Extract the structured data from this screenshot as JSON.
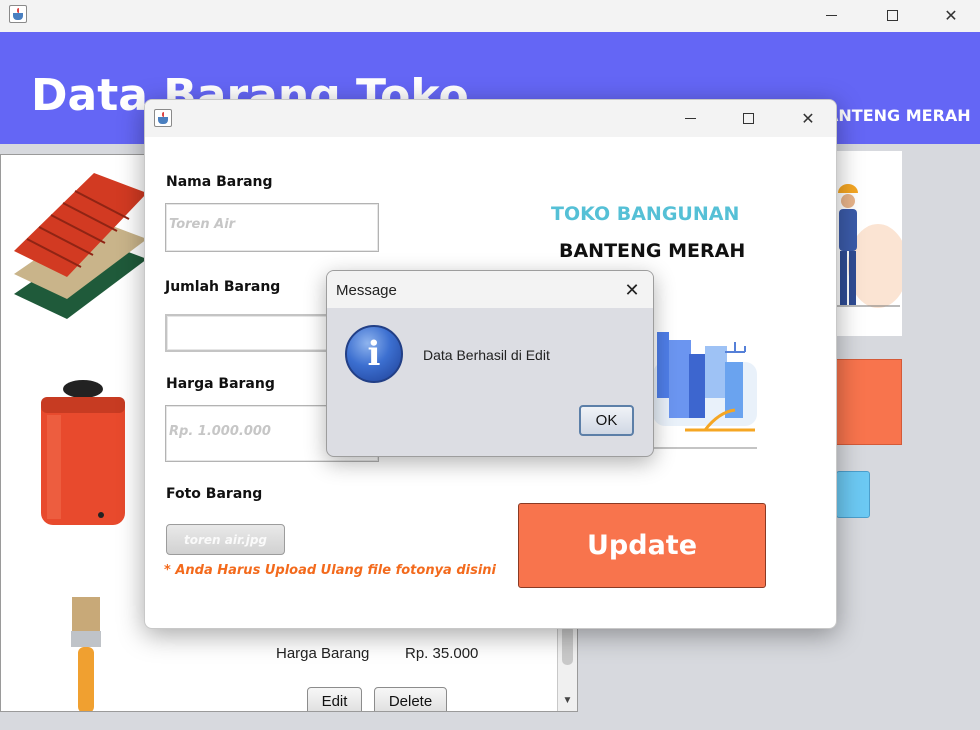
{
  "main_window": {
    "title": "Data Barang Toko",
    "shop_name_partial": "ANTENG MERAH"
  },
  "list": {
    "row": {
      "label": "Harga Barang",
      "value": "Rp. 35.000",
      "edit_label": "Edit",
      "delete_label": "Delete"
    }
  },
  "edit_dialog": {
    "fields": {
      "name_label": "Nama Barang",
      "name_placeholder": "Toren Air",
      "qty_label": "Jumlah Barang",
      "qty_value": "",
      "price_label": "Harga Barang",
      "price_placeholder": "Rp. 1.000.000",
      "photo_label": "Foto Barang",
      "photo_file": "toren air.jpg"
    },
    "note": "* Anda Harus Upload Ulang file fotonya disini",
    "brand_line1": "TOKO BANGUNAN",
    "brand_line2": "BANTENG MERAH",
    "update_label": "Update"
  },
  "message_dialog": {
    "title": "Message",
    "text": "Data Berhasil di Edit",
    "ok_label": "OK"
  },
  "colors": {
    "header": "#6466f5",
    "accent_orange": "#f8744d",
    "brand_teal": "#55c0d6",
    "note_orange": "#f36a1c"
  }
}
